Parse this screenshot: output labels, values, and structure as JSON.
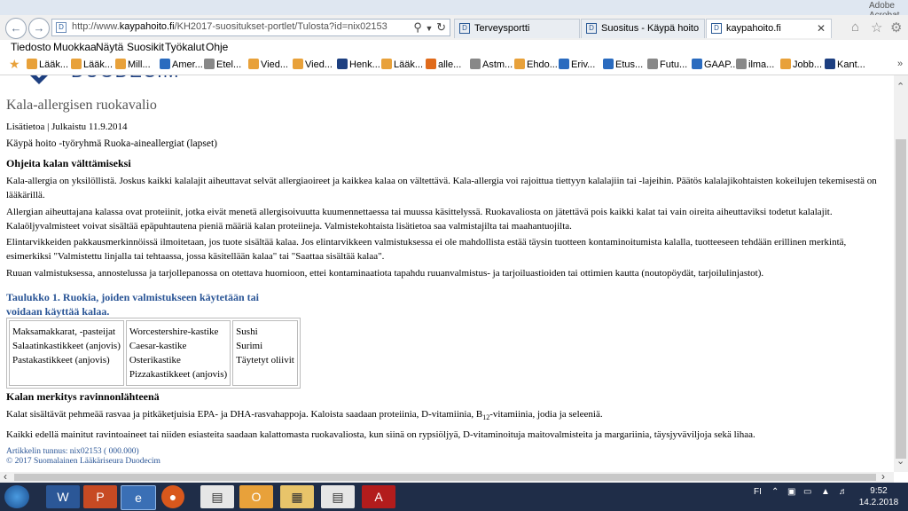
{
  "window": {
    "title": "Adobe Acrobat Reader DC"
  },
  "address_bar": {
    "url_prefix": "http://www.",
    "url_host": "kaypahoito.fi",
    "url_path": "/KH2017-suositukset-portlet/Tulosta?id=nix02153"
  },
  "tabs": [
    {
      "label": "Terveysportti",
      "active": false
    },
    {
      "label": "Suositus - Käypä hoito",
      "active": false
    },
    {
      "label": "kaypahoito.fi",
      "active": true
    }
  ],
  "menu": [
    "Tiedosto",
    "Muokkaa",
    "Näytä",
    "Suosikit",
    "Työkalut",
    "Ohje"
  ],
  "favorites": [
    "Lääk...",
    "Lääk...",
    "Mill...",
    "Amer...",
    "Etel...",
    "Vied...",
    "Vied...",
    "Henk...",
    "Lääk...",
    "alle...",
    "Astm...",
    "Ehdo...",
    "Eriv...",
    "Etus...",
    "Futu...",
    "GAAP...",
    "ilma...",
    "Jobb...",
    "Kant..."
  ],
  "favorite_colors": [
    "#e8a13a",
    "#e8a13a",
    "#e8a13a",
    "#2a6bbf",
    "#888888",
    "#e8a13a",
    "#e8a13a",
    "#1d3f80",
    "#e8a13a",
    "#e06a1a",
    "#888888",
    "#e8a13a",
    "#2a6bbf",
    "#2a6bbf",
    "#888888",
    "#2a6bbf",
    "#888888",
    "#e8a13a",
    "#1d3f80"
  ],
  "page": {
    "logo_text": "DUODECIM",
    "title": "Kala-allergisen ruokavalio",
    "meta": "Lisätietoa | Julkaistu 11.9.2014",
    "group": "Käypä hoito -työryhmä Ruoka-aineallergiat (lapset)",
    "section1_heading": "Ohjeita kalan välttämiseksi",
    "p1": "Kala-allergia on yksilöllistä. Joskus kaikki kalalajit aiheuttavat selvät allergiaoireet ja kaikkea kalaa on vältettävä. Kala-allergia voi rajoittua tiettyyn kalalajiin tai -lajeihin. Päätös kalalajikohtaisten kokeilujen tekemisestä on lääkärillä.",
    "p2": "Allergian aiheuttajana kalassa ovat proteiinit, jotka eivät menetä allergisoivuutta kuumennettaessa tai muussa käsittelyssä. Ruokavaliosta on jätettävä pois kaikki kalat tai vain oireita aiheuttaviksi todetut kalalajit. Kalaöljyvalmisteet voivat sisältää epäpuhtautena pieniä määriä kalan proteiineja. Valmistekohtaista lisätietoa saa valmistajilta tai maahantuojilta.",
    "p3": "Elintarvikkeiden pakkausmerkinnöissä ilmoitetaan, jos tuote sisältää kalaa. Jos elintarvikkeen valmistuksessa ei ole mahdollista estää täysin tuotteen kontaminoitumista kalalla, tuotteeseen tehdään erillinen merkintä, esimerkiksi \"Valmistettu linjalla tai tehtaassa, jossa käsitellään kalaa\" tai \"Saattaa sisältää kalaa\".",
    "p4": "Ruuan valmistuksessa, annostelussa ja tarjollepanossa on otettava huomioon, ettei kontaminaatiota tapahdu ruuanvalmistus- ja tarjoiluastioiden tai ottimien kautta (noutopöydät, tarjoilulinjastot).",
    "table_caption_line1": "Taulukko 1. Ruokia, joiden valmistukseen käytetään tai",
    "table_caption_line2": "voidaan käyttää kalaa.",
    "table_columns": [
      [
        "Maksamakkarat, -pasteijat",
        "Salaatinkastikkeet (anjovis)",
        "Pastakastikkeet (anjovis)"
      ],
      [
        "Worcestershire-kastike",
        "Caesar-kastike",
        "Osterikastike",
        "Pizzakastikkeet (anjovis)"
      ],
      [
        "Sushi",
        "Surimi",
        "Täytetyt oliivit"
      ]
    ],
    "section2_heading": "Kalan merkitys ravinnonlähteenä",
    "p5_before": "Kalat sisältävät pehmeää rasvaa ja pitkäketjuisia EPA- ja DHA-rasvahappoja. Kaloista saadaan proteiinia, D-vitamiinia, B",
    "p5_sub": "12",
    "p5_after": "-vitamiinia, jodia ja seleeniä.",
    "p6": "Kaikki edellä mainitut ravintoaineet tai niiden esiasteita saadaan kalattomasta ruokavaliosta, kun siinä on rypsiöljyä, D-vitaminoituja maitovalmisteita ja margariinia, täysjyväviljoja sekä lihaa.",
    "footer_line1": "Artikkelin tunnus: nix02153 ( 000.000)",
    "footer_line2": "© 2017 Suomalainen Lääkäriseura Duodecim"
  },
  "taskbar": {
    "language": "FI",
    "time": "9:52",
    "date": "14.2.2018"
  }
}
